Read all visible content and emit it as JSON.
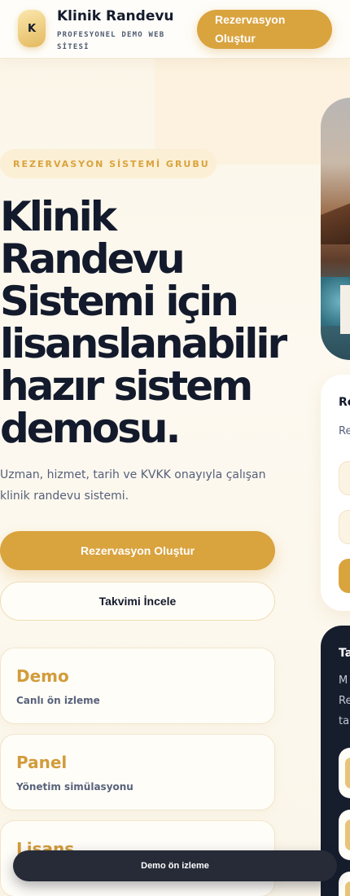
{
  "header": {
    "logo_letter": "K",
    "title": "Klinik Randevu",
    "subtitle": "PROFESYONEL DEMO WEB SİTESİ",
    "cta_label": "Rezervasyon Oluştur"
  },
  "hero": {
    "eyebrow": "REZERVASYON SİSTEMİ GRUBU",
    "title": "Klinik Randevu Sistemi için lisanslanabilir hazır sistem demosu.",
    "description": "Uzman, hizmet, tarih ve KVKK onayıyla çalışan klinik randevu sistemi.",
    "primary_button": "Rezervasyon Oluştur",
    "secondary_button": "Takvimi İncele"
  },
  "stats": [
    {
      "value": "Demo",
      "label": "Canlı ön izleme"
    },
    {
      "value": "Panel",
      "label": "Yönetim simülasyonu"
    },
    {
      "value": "Lisans",
      "label": ""
    }
  ],
  "side": {
    "form_title": "Re",
    "form_sub": "Re",
    "dark_title": "Ta",
    "dark_lines": [
      "M",
      "Re",
      "ta"
    ]
  },
  "preview_pill": "Demo ön izleme",
  "colors": {
    "accent": "#d9a33e",
    "dark": "#131a2c",
    "background": "#fbf5e7"
  }
}
